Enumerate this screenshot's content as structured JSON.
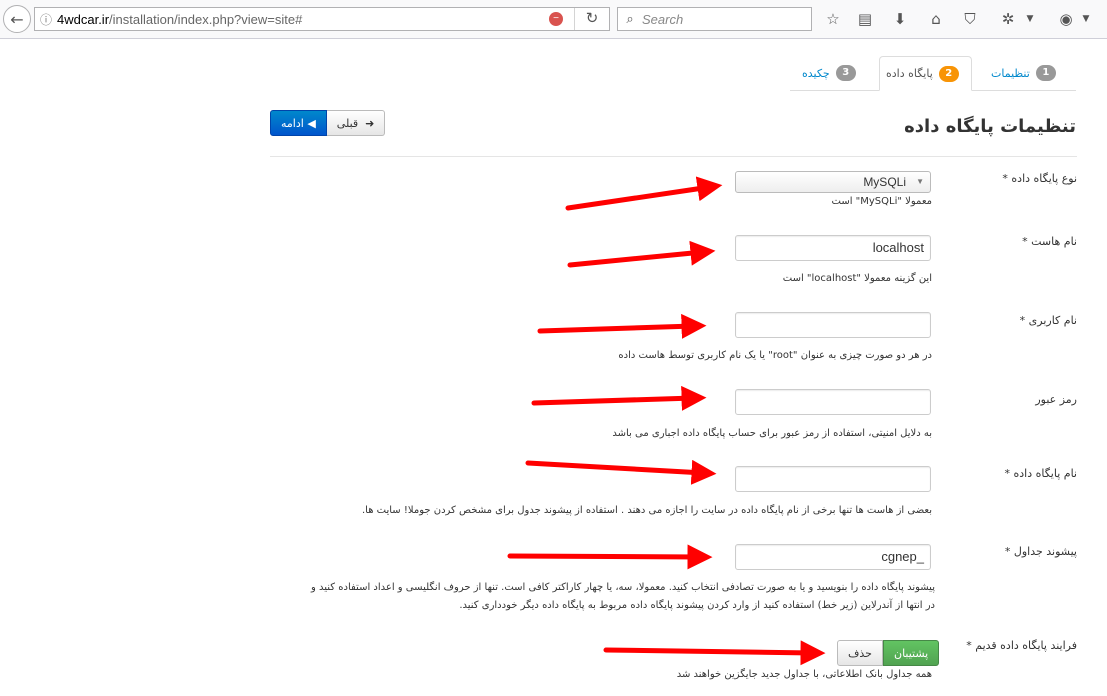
{
  "browser": {
    "url_host": "4wdcar.ir",
    "url_path": "/installation/index.php?view=site#",
    "search_placeholder": "Search"
  },
  "tabs": [
    {
      "number": "1",
      "label": "تنظیمات",
      "active": false
    },
    {
      "number": "2",
      "label": "پایگاه داده",
      "active": true
    },
    {
      "number": "3",
      "label": "چکیده",
      "active": false
    }
  ],
  "buttons": {
    "previous": "قبلی",
    "next": "ادامه"
  },
  "page_title": "تنظیمات پایگاه داده",
  "form": {
    "db_type": {
      "label": "نوع پایگاه داده *",
      "value": "MySQLi",
      "help": "معمولا \"MySQLi\" است"
    },
    "host": {
      "label": "نام هاست *",
      "value": "localhost",
      "help": "این گزینه معمولا \"localhost\" است"
    },
    "username": {
      "label": "نام کاربری *",
      "value": "",
      "help": "در هر دو صورت چیزی به عنوان \"root\" یا یک نام کاربری توسط هاست داده"
    },
    "password": {
      "label": "رمز عبور",
      "value": "",
      "help": "به دلایل امنیتی، استفاده از رمز عبور برای حساب پایگاه داده اجباری می باشد"
    },
    "db_name": {
      "label": "نام پایگاه داده *",
      "value": "",
      "help": "بعضی از هاست ها تنها برخی از نام پایگاه داده در سایت را اجازه می دهند . استفاده از پیشوند جدول برای مشخص کردن جوملا! سایت ها."
    },
    "prefix": {
      "label": "پیشوند جداول *",
      "value": "cgnep_",
      "help_line1": "پیشوند پایگاه داده را بنویسید و یا به صورت تصادفی انتخاب کنید. معمولا، سه، یا چهار کاراکتر کافی است. تنها از حروف انگلیسی و اعداد استفاده کنید و",
      "help_line2": "در انتها از آندرلاین (زیر خط) استفاده کنید از وارد کردن پیشوند پایگاه داده مربوط به پایگاه داده دیگر خودداری کنید."
    },
    "old_db": {
      "label": "فرایند پایگاه داده قدیم *",
      "option_on": "پشتیبان",
      "option_off": "حذف",
      "help": "همه جداول بانک اطلاعاتی، با جداول جدید جایگزین خواهند شد"
    }
  },
  "colors": {
    "accent": "#0088cc",
    "badge_active": "#f89406",
    "toggle_on": "#5cb85c",
    "annotation_arrow": "#ff0000"
  }
}
